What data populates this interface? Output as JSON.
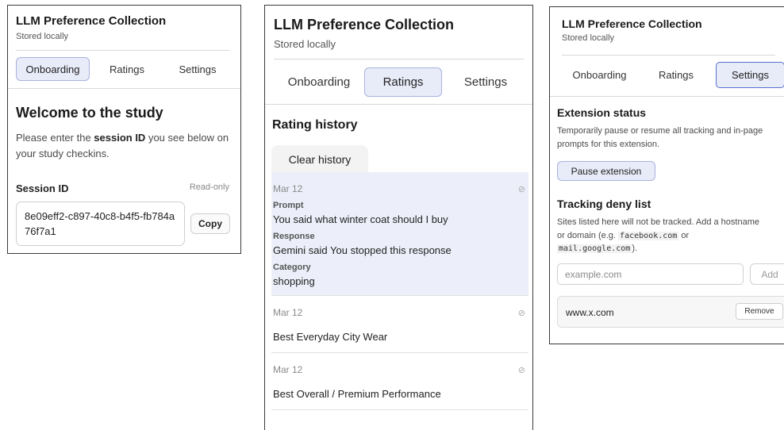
{
  "app": {
    "title": "LLM Preference Collection",
    "subtitle": "Stored locally"
  },
  "tabs": {
    "onboarding": "Onboarding",
    "ratings": "Ratings",
    "settings": "Settings"
  },
  "onboarding": {
    "heading": "Welcome to the study",
    "text_before": "Please enter the ",
    "text_bold": "session ID",
    "text_after": " you see below on your study checkins.",
    "session_label": "Session ID",
    "readonly_label": "Read-only",
    "session_id": "8e09eff2-c897-40c8-b4f5-fb784a76f7a1",
    "copy_label": "Copy"
  },
  "ratings": {
    "heading": "Rating history",
    "clear_label": "Clear history",
    "prompt_label": "Prompt",
    "response_label": "Response",
    "category_label": "Category",
    "entries": [
      {
        "date": "Mar 12",
        "prompt": "You said what winter coat should I buy",
        "response": "Gemini said You stopped this response",
        "category": "shopping"
      },
      {
        "date": "Mar 12",
        "title": "Best Everyday City Wear"
      },
      {
        "date": "Mar 12",
        "title": "Best Overall / Premium Performance"
      }
    ]
  },
  "settings": {
    "ext_heading": "Extension status",
    "ext_text": "Temporarily pause or resume all tracking and in-page prompts for this extension.",
    "pause_label": "Pause extension",
    "deny_heading": "Tracking deny list",
    "deny_text_1": "Sites listed here will not be tracked. Add a hostname",
    "deny_text_2": "or domain (e.g. ",
    "deny_code_1": "facebook.com",
    "deny_text_3": " or",
    "deny_code_2": "mail.google.com",
    "deny_text_4": ").",
    "host_placeholder": "example.com",
    "add_label": "Add",
    "deny_list": [
      "www.x.com"
    ],
    "remove_label": "Remove"
  },
  "icons": {
    "entry_action": "dismiss-circle-slash-icon"
  },
  "colors": {
    "active_tab_bg": "#e8ebf8",
    "active_tab_border": "#a9b2de",
    "focus_border": "#5a6fd0",
    "expanded_entry_bg": "#eceff9"
  }
}
